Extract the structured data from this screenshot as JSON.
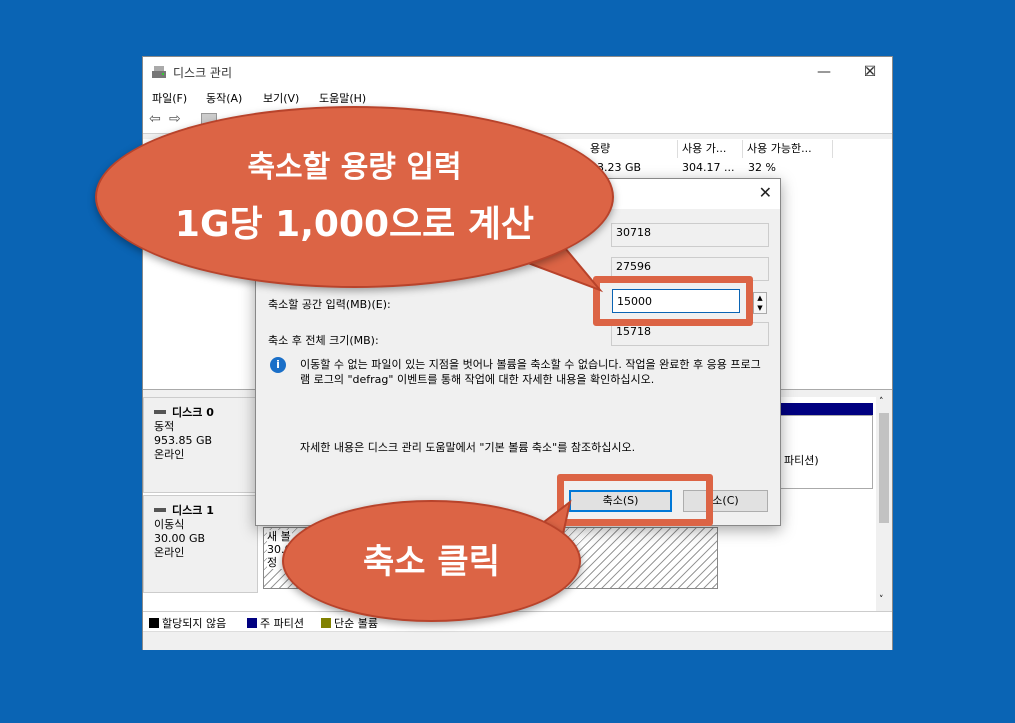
{
  "window": {
    "title": "디스크 관리",
    "controls": {
      "minimize": "—",
      "maximize": "☐",
      "close": "✕"
    }
  },
  "menu": [
    "파일(F)",
    "동작(A)",
    "보기(V)",
    "도움말(H)"
  ],
  "toolbar": {
    "back": "⇦",
    "forward": "⇨"
  },
  "volume_table": {
    "headers": [
      "용량",
      "사용 가...",
      "사용 가능한..."
    ],
    "row": [
      "53.23 GB",
      "304.17 ...",
      "32 %"
    ]
  },
  "disks": [
    {
      "name": "디스크 0",
      "type": "동적",
      "size": "953.85 GB",
      "status": "온라인"
    },
    {
      "name": "디스크 1",
      "type": "이동식",
      "size": "30.00 GB",
      "status": "온라인"
    }
  ],
  "partition_fragments": {
    "label": "파티션)",
    "line1": "새 볼",
    "line2": "30.0",
    "line3": "정"
  },
  "legend": [
    {
      "label": "할당되지 않음",
      "color": "#000000"
    },
    {
      "label": "주 파티션",
      "color": "#000080"
    },
    {
      "label": "단순 볼륨",
      "color": "#808000"
    }
  ],
  "dialog": {
    "close": "✕",
    "rows": [
      {
        "value": "30718"
      },
      {
        "value": "27596"
      }
    ],
    "shrink_label": "축소할 공간 입력(MB)(E):",
    "shrink_value": "15000",
    "after_label": "축소 후 전체 크기(MB):",
    "after_value": "15718",
    "info_icon": "i",
    "info_text": "이동할 수 없는 파일이 있는 지점을 벗어나 볼륨을 축소할 수 없습니다. 작업을 완료한 후 응용 프로그램 로그의 \"defrag\" 이벤트를 통해 작업에 대한 자세한 내용을 확인하십시오.",
    "help_text": "자세한 내용은 디스크 관리 도움말에서 \"기본 볼륨 축소\"를 참조하십시오.",
    "shrink_button": "축소(S)",
    "cancel_button": "소(C)"
  },
  "annotations": {
    "bubble1_line1": "축소할 용량 입력",
    "bubble1_line2": "1G당 1,000으로 계산",
    "bubble2": "축소 클릭",
    "accent": "#dc6445"
  }
}
